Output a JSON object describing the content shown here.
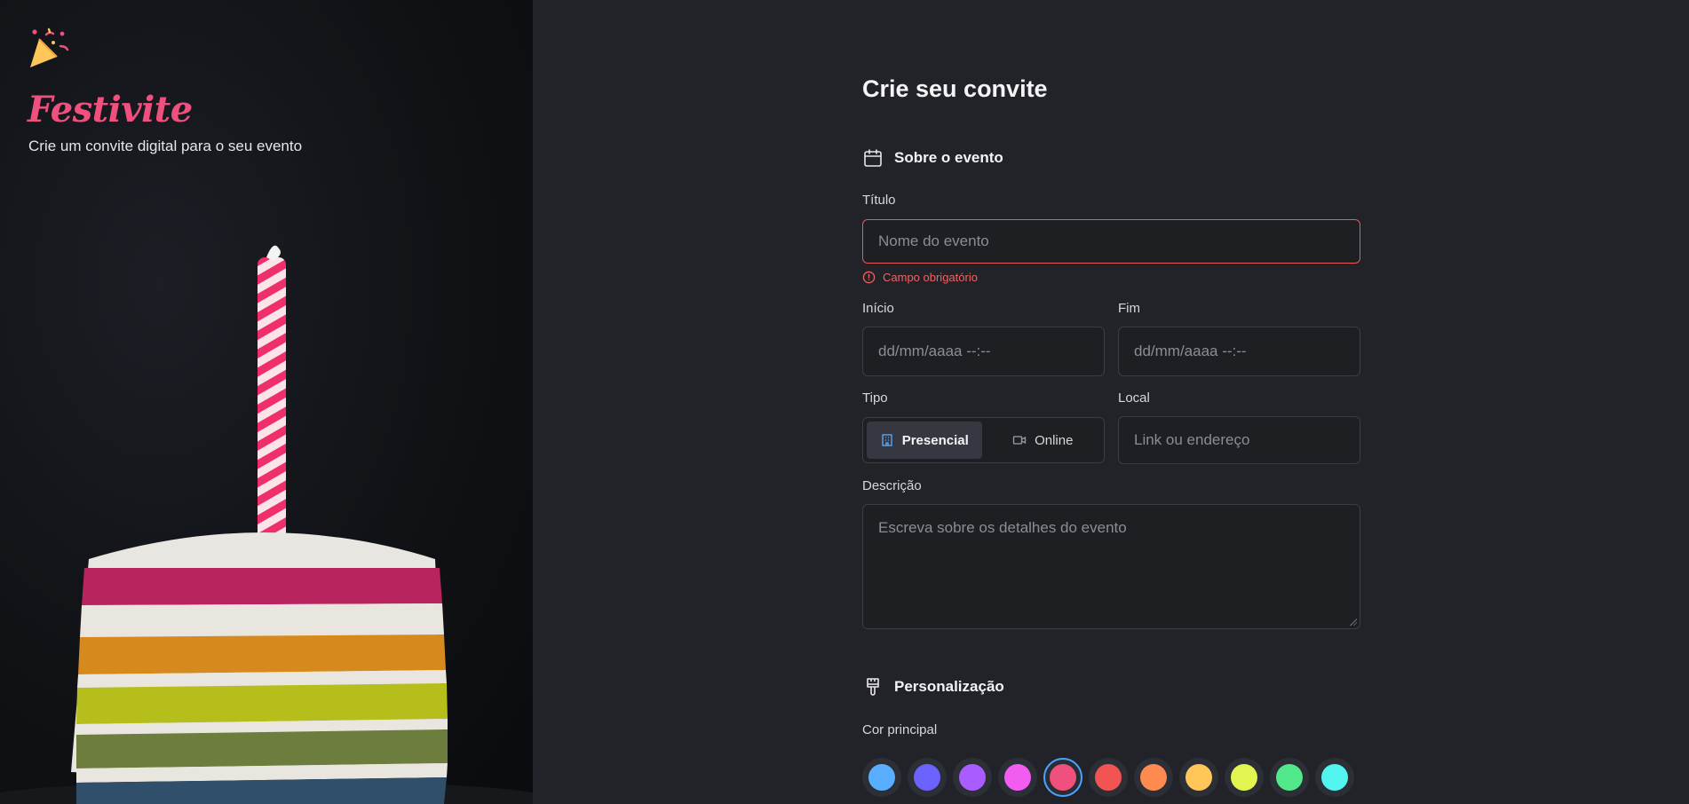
{
  "brand": {
    "name": "Festivite",
    "tagline": "Crie um convite digital para o seu evento",
    "color": "#f0507e"
  },
  "form": {
    "title": "Crie seu convite",
    "section_event": {
      "title": "Sobre o evento",
      "icon": "calendar-icon"
    },
    "title_field": {
      "label": "Título",
      "placeholder": "Nome do evento",
      "error": "Campo obrigatório"
    },
    "start_field": {
      "label": "Início",
      "placeholder": "dd/mm/aaaa --:--"
    },
    "end_field": {
      "label": "Fim",
      "placeholder": "dd/mm/aaaa --:--"
    },
    "type_field": {
      "label": "Tipo",
      "options": [
        {
          "label": "Presencial",
          "icon": "building-icon",
          "selected": true
        },
        {
          "label": "Online",
          "icon": "video-icon",
          "selected": false
        }
      ]
    },
    "location_field": {
      "label": "Local",
      "placeholder": "Link ou endereço"
    },
    "description_field": {
      "label": "Descrição",
      "placeholder": "Escreva sobre os detalhes do evento"
    },
    "section_custom": {
      "title": "Personalização",
      "icon": "paintbrush-icon"
    },
    "color_field": {
      "label": "Cor principal",
      "selected_index": 4,
      "colors": [
        "#5aaeff",
        "#6c63ff",
        "#a95cff",
        "#f35cf0",
        "#f0507e",
        "#f25454",
        "#ff8a4f",
        "#ffc65a",
        "#e2f44f",
        "#52e98a",
        "#52f4f0"
      ]
    }
  },
  "theme": {
    "background": "#212328",
    "error": "#f36262",
    "accent": "#4da3ff"
  }
}
